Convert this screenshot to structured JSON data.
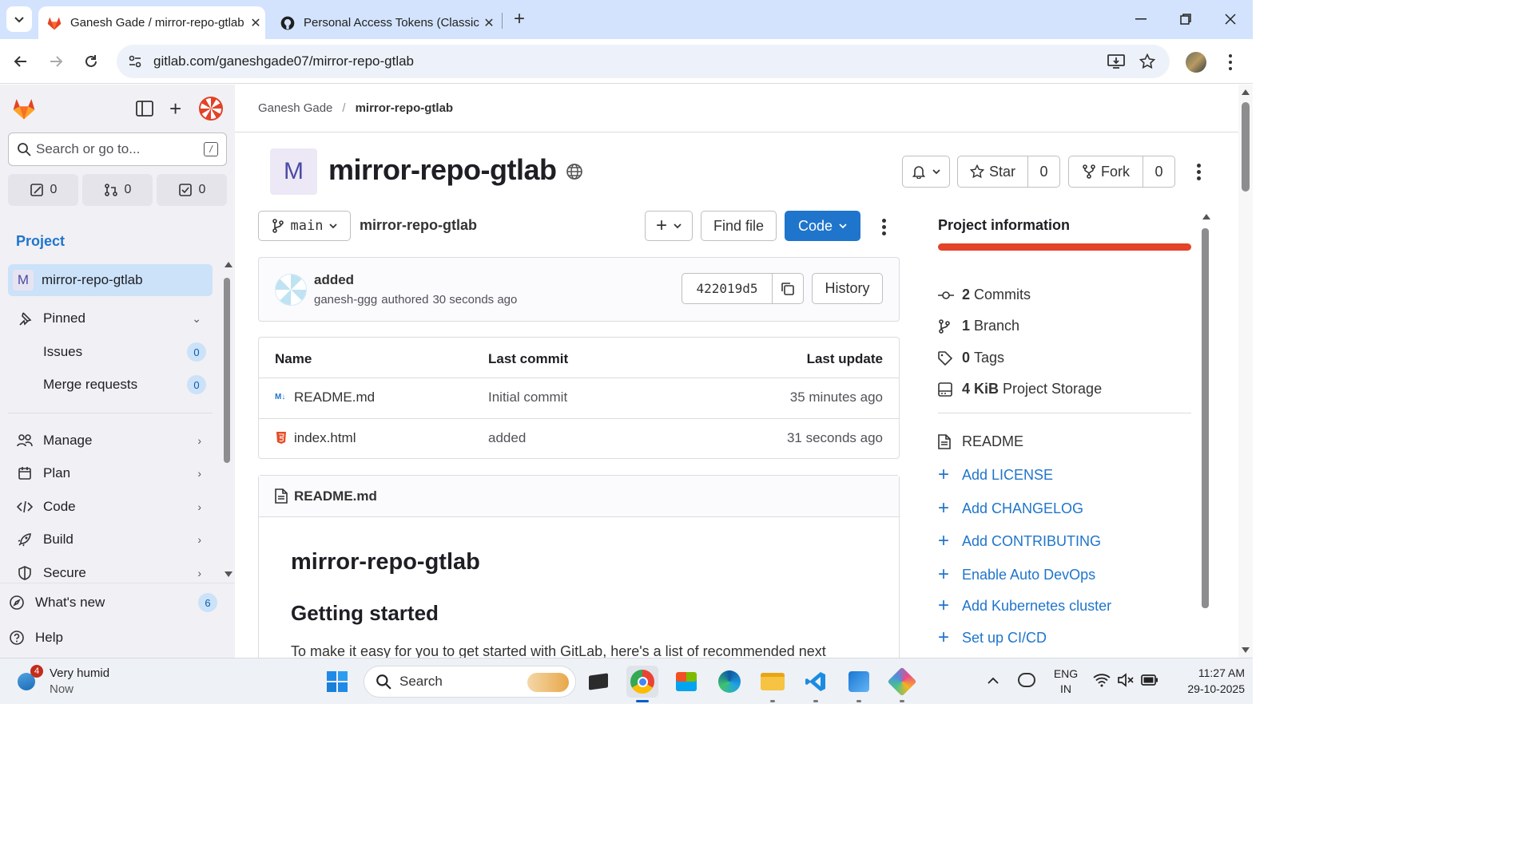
{
  "browser": {
    "tabs": [
      {
        "title": "Ganesh Gade / mirror-repo-gtlab",
        "active": true
      },
      {
        "title": "Personal Access Tokens (Classic)",
        "active": false
      }
    ],
    "url": "gitlab.com/ganeshgade07/mirror-repo-gtlab"
  },
  "sidebar": {
    "search_placeholder": "Search or go to...",
    "search_shortcut": "/",
    "counters": {
      "issues": "0",
      "merge_requests": "0",
      "todos": "0"
    },
    "section_title": "Project",
    "project_avatar": "M",
    "project_name": "mirror-repo-gtlab",
    "pinned_label": "Pinned",
    "pinned_items": [
      {
        "label": "Issues",
        "count": "0"
      },
      {
        "label": "Merge requests",
        "count": "0"
      }
    ],
    "nav_items": [
      "Manage",
      "Plan",
      "Code",
      "Build",
      "Secure"
    ],
    "whats_new": {
      "label": "What's new",
      "count": "6"
    },
    "help_label": "Help"
  },
  "breadcrumb": {
    "owner": "Ganesh Gade",
    "separator": "/",
    "project": "mirror-repo-gtlab"
  },
  "project": {
    "avatar_letter": "M",
    "title": "mirror-repo-gtlab",
    "star_label": "Star",
    "star_count": "0",
    "fork_label": "Fork",
    "fork_count": "0"
  },
  "repo_bar": {
    "branch": "main",
    "path": "mirror-repo-gtlab",
    "find_file": "Find file",
    "code_button": "Code"
  },
  "last_commit": {
    "message": "added",
    "author": "ganesh-ggg",
    "authored_text": "authored",
    "time": "30 seconds ago",
    "sha": "422019d5",
    "history_label": "History"
  },
  "file_table": {
    "headers": {
      "name": "Name",
      "last_commit": "Last commit",
      "last_update": "Last update"
    },
    "rows": [
      {
        "name": "README.md",
        "commit": "Initial commit",
        "updated": "35 minutes ago"
      },
      {
        "name": "index.html",
        "commit": "added",
        "updated": "31 seconds ago"
      }
    ]
  },
  "readme": {
    "header": "README.md",
    "h1": "mirror-repo-gtlab",
    "h2": "Getting started",
    "para": "To make it easy for you to get started with GitLab, here's a list of recommended next"
  },
  "project_info": {
    "title": "Project information",
    "progress_color": "#e24329",
    "stats": [
      {
        "value": "2",
        "label": "Commits"
      },
      {
        "value": "1",
        "label": "Branch"
      },
      {
        "value": "0",
        "label": "Tags"
      },
      {
        "value": "4 KiB",
        "label": "Project Storage"
      }
    ],
    "readme_label": "README",
    "links": [
      "Add LICENSE",
      "Add CHANGELOG",
      "Add CONTRIBUTING",
      "Enable Auto DevOps",
      "Add Kubernetes cluster",
      "Set up CI/CD"
    ]
  },
  "taskbar": {
    "weather_badge": "4",
    "weather_title": "Very humid",
    "weather_sub": "Now",
    "search_label": "Search",
    "lang_top": "ENG",
    "lang_bottom": "IN",
    "time": "11:27 AM",
    "date": "29-10-2025"
  },
  "colors": {
    "accent": "#1f75cb",
    "gitlab_orange": "#e24329",
    "sidebar_bg": "#f1f0f5"
  }
}
